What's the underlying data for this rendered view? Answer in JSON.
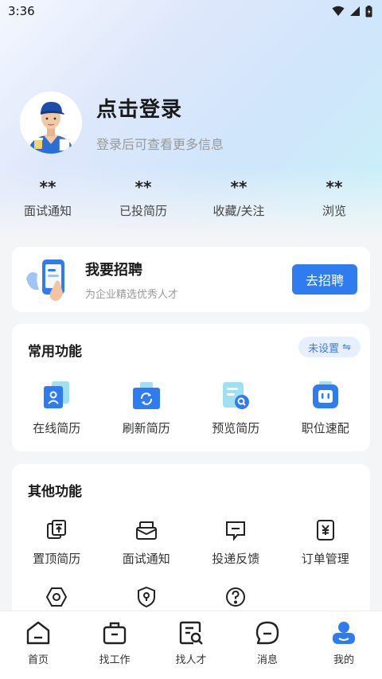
{
  "status_bar": {
    "time": "3:36"
  },
  "profile": {
    "title": "点击登录",
    "subtitle": "登录后可查看更多信息"
  },
  "stats": [
    {
      "value": "**",
      "label": "面试通知"
    },
    {
      "value": "**",
      "label": "已投简历"
    },
    {
      "value": "**",
      "label": "收藏/关注"
    },
    {
      "value": "**",
      "label": "浏览"
    }
  ],
  "recruit": {
    "title": "我要招聘",
    "subtitle": "为企业精选优秀人才",
    "button": "去招聘"
  },
  "common_functions": {
    "title": "常用功能",
    "pill": "未设置",
    "pill_icon": "⇋",
    "items": [
      {
        "label": "在线简历",
        "icon": "resume-icon"
      },
      {
        "label": "刷新简历",
        "icon": "refresh-icon"
      },
      {
        "label": "预览简历",
        "icon": "preview-icon"
      },
      {
        "label": "职位速配",
        "icon": "match-icon"
      }
    ]
  },
  "other_functions": {
    "title": "其他功能",
    "items": [
      {
        "label": "置顶简历",
        "icon": "pin-top-icon"
      },
      {
        "label": "面试通知",
        "icon": "mail-icon"
      },
      {
        "label": "投递反馈",
        "icon": "feedback-icon"
      },
      {
        "label": "订单管理",
        "icon": "order-icon"
      },
      {
        "label": "",
        "icon": "settings-icon"
      },
      {
        "label": "",
        "icon": "location-shield-icon"
      },
      {
        "label": "",
        "icon": "help-icon"
      }
    ]
  },
  "tabbar": {
    "items": [
      {
        "label": "首页",
        "icon": "home-icon"
      },
      {
        "label": "找工作",
        "icon": "briefcase-icon"
      },
      {
        "label": "找人才",
        "icon": "talent-search-icon"
      },
      {
        "label": "消息",
        "icon": "message-icon"
      },
      {
        "label": "我的",
        "icon": "profile-icon",
        "active": true
      }
    ]
  },
  "colors": {
    "accent": "#2f7cf0",
    "pill_bg": "#e6effd",
    "pill_text": "#3b7bea"
  }
}
